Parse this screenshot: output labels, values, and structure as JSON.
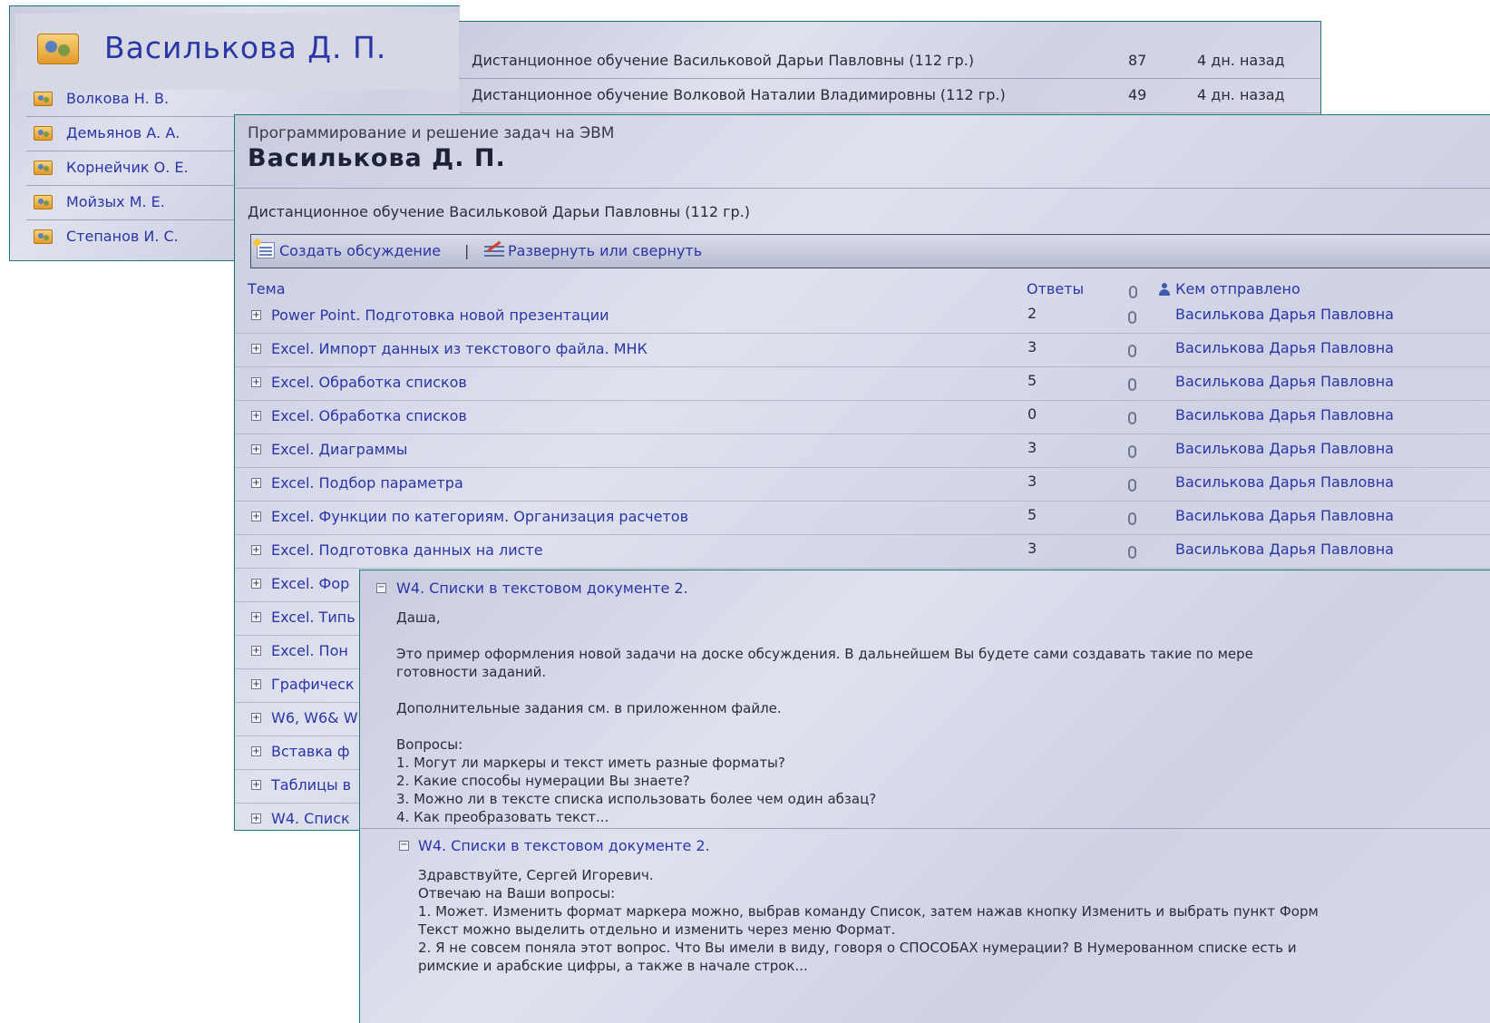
{
  "contacts_panel": {
    "title": "Василькова Д. П.",
    "items": [
      {
        "name": "Волкова Н. В."
      },
      {
        "name": "Демьянов А. А."
      },
      {
        "name": "Корнейчик О. Е."
      },
      {
        "name": "Мойзых М. Е."
      },
      {
        "name": "Степанов И. С."
      }
    ]
  },
  "courses_panel": {
    "rows": [
      {
        "title": "Дистанционное обучение Васильковой Дарьи Павловны (112 гр.)",
        "count": "87",
        "date": "4 дн. назад"
      },
      {
        "title": "Дистанционное обучение Волковой Наталии Владимировны (112 гр.)",
        "count": "49",
        "date": "4 дн. назад"
      }
    ]
  },
  "discussion_panel": {
    "subtitle": "Программирование и решение задач на ЭВМ",
    "title": "Василькова Д. П.",
    "course": "Дистанционное обучение Васильковой Дарьи Павловны (112 гр.)",
    "toolbar": {
      "new_label": "Создать обсуждение",
      "separator": "|",
      "expand_label": "Развернуть или свернуть"
    },
    "columns": {
      "topic": "Тема",
      "replies": "Ответы",
      "sender": "Кем отправлено"
    },
    "rows": [
      {
        "topic": "Power Point. Подготовка новой презентации",
        "replies": "2",
        "sender": "Василькова Дарья Павловна"
      },
      {
        "topic": "Excel. Импорт данных из текстового файла. МНК",
        "replies": "3",
        "sender": "Василькова Дарья Павловна"
      },
      {
        "topic": "Excel. Обработка списков",
        "replies": "5",
        "sender": "Василькова Дарья Павловна"
      },
      {
        "topic": "Excel. Обработка списков",
        "replies": "0",
        "sender": "Василькова Дарья Павловна"
      },
      {
        "topic": "Excel. Диаграммы",
        "replies": "3",
        "sender": "Василькова Дарья Павловна"
      },
      {
        "topic": "Excel. Подбор параметра",
        "replies": "3",
        "sender": "Василькова Дарья Павловна"
      },
      {
        "topic": "Excel. Функции по категориям. Организация расчетов",
        "replies": "5",
        "sender": "Василькова Дарья Павловна"
      },
      {
        "topic": "Excel. Подготовка данных на листе",
        "replies": "3",
        "sender": "Василькова Дарья Павловна"
      }
    ],
    "partial_rows": [
      {
        "topic": "Excel. Фор"
      },
      {
        "topic": "Excel. Типь"
      },
      {
        "topic": "Excel. Пон"
      },
      {
        "topic": "Графическ"
      },
      {
        "topic": "W6, W6& W"
      },
      {
        "topic": "Вставка ф"
      },
      {
        "topic": "Таблицы в"
      },
      {
        "topic": "W4. Списк"
      }
    ]
  },
  "message_panel": {
    "post1": {
      "title": "W4. Списки в текстовом документе 2.",
      "body": "Даша,\n\nЭто пример оформления новой задачи на доске обсуждения. В дальнейшем Вы будете сами создавать такие по мере\nготовности заданий.\n\nДополнительные задания см. в приложенном файле.\n\nВопросы:\n1. Могут ли маркеры и текст иметь разные форматы?\n2. Какие способы нумерации Вы знаете?\n3. Можно ли в тексте списка использовать более чем один абзац?\n4. Как преобразовать текст..."
    },
    "post2": {
      "title": "W4. Списки в текстовом документе 2.",
      "body": "Здравствуйте, Сергей Игоревич.\nОтвечаю на Ваши вопросы:\n1. Может. Изменить формат маркера можно, выбрав команду Список, затем нажав кнопку Изменить и выбрать пункт Форм\nТекст можно выделить отдельно и изменить через меню Формат.\n2. Я не совсем поняла этот вопрос. Что Вы имели в виду, говоря о СПОСОБАХ нумерации? В Нумерованном списке есть и\nримские и арабские цифры, а также в начале строк..."
    }
  }
}
